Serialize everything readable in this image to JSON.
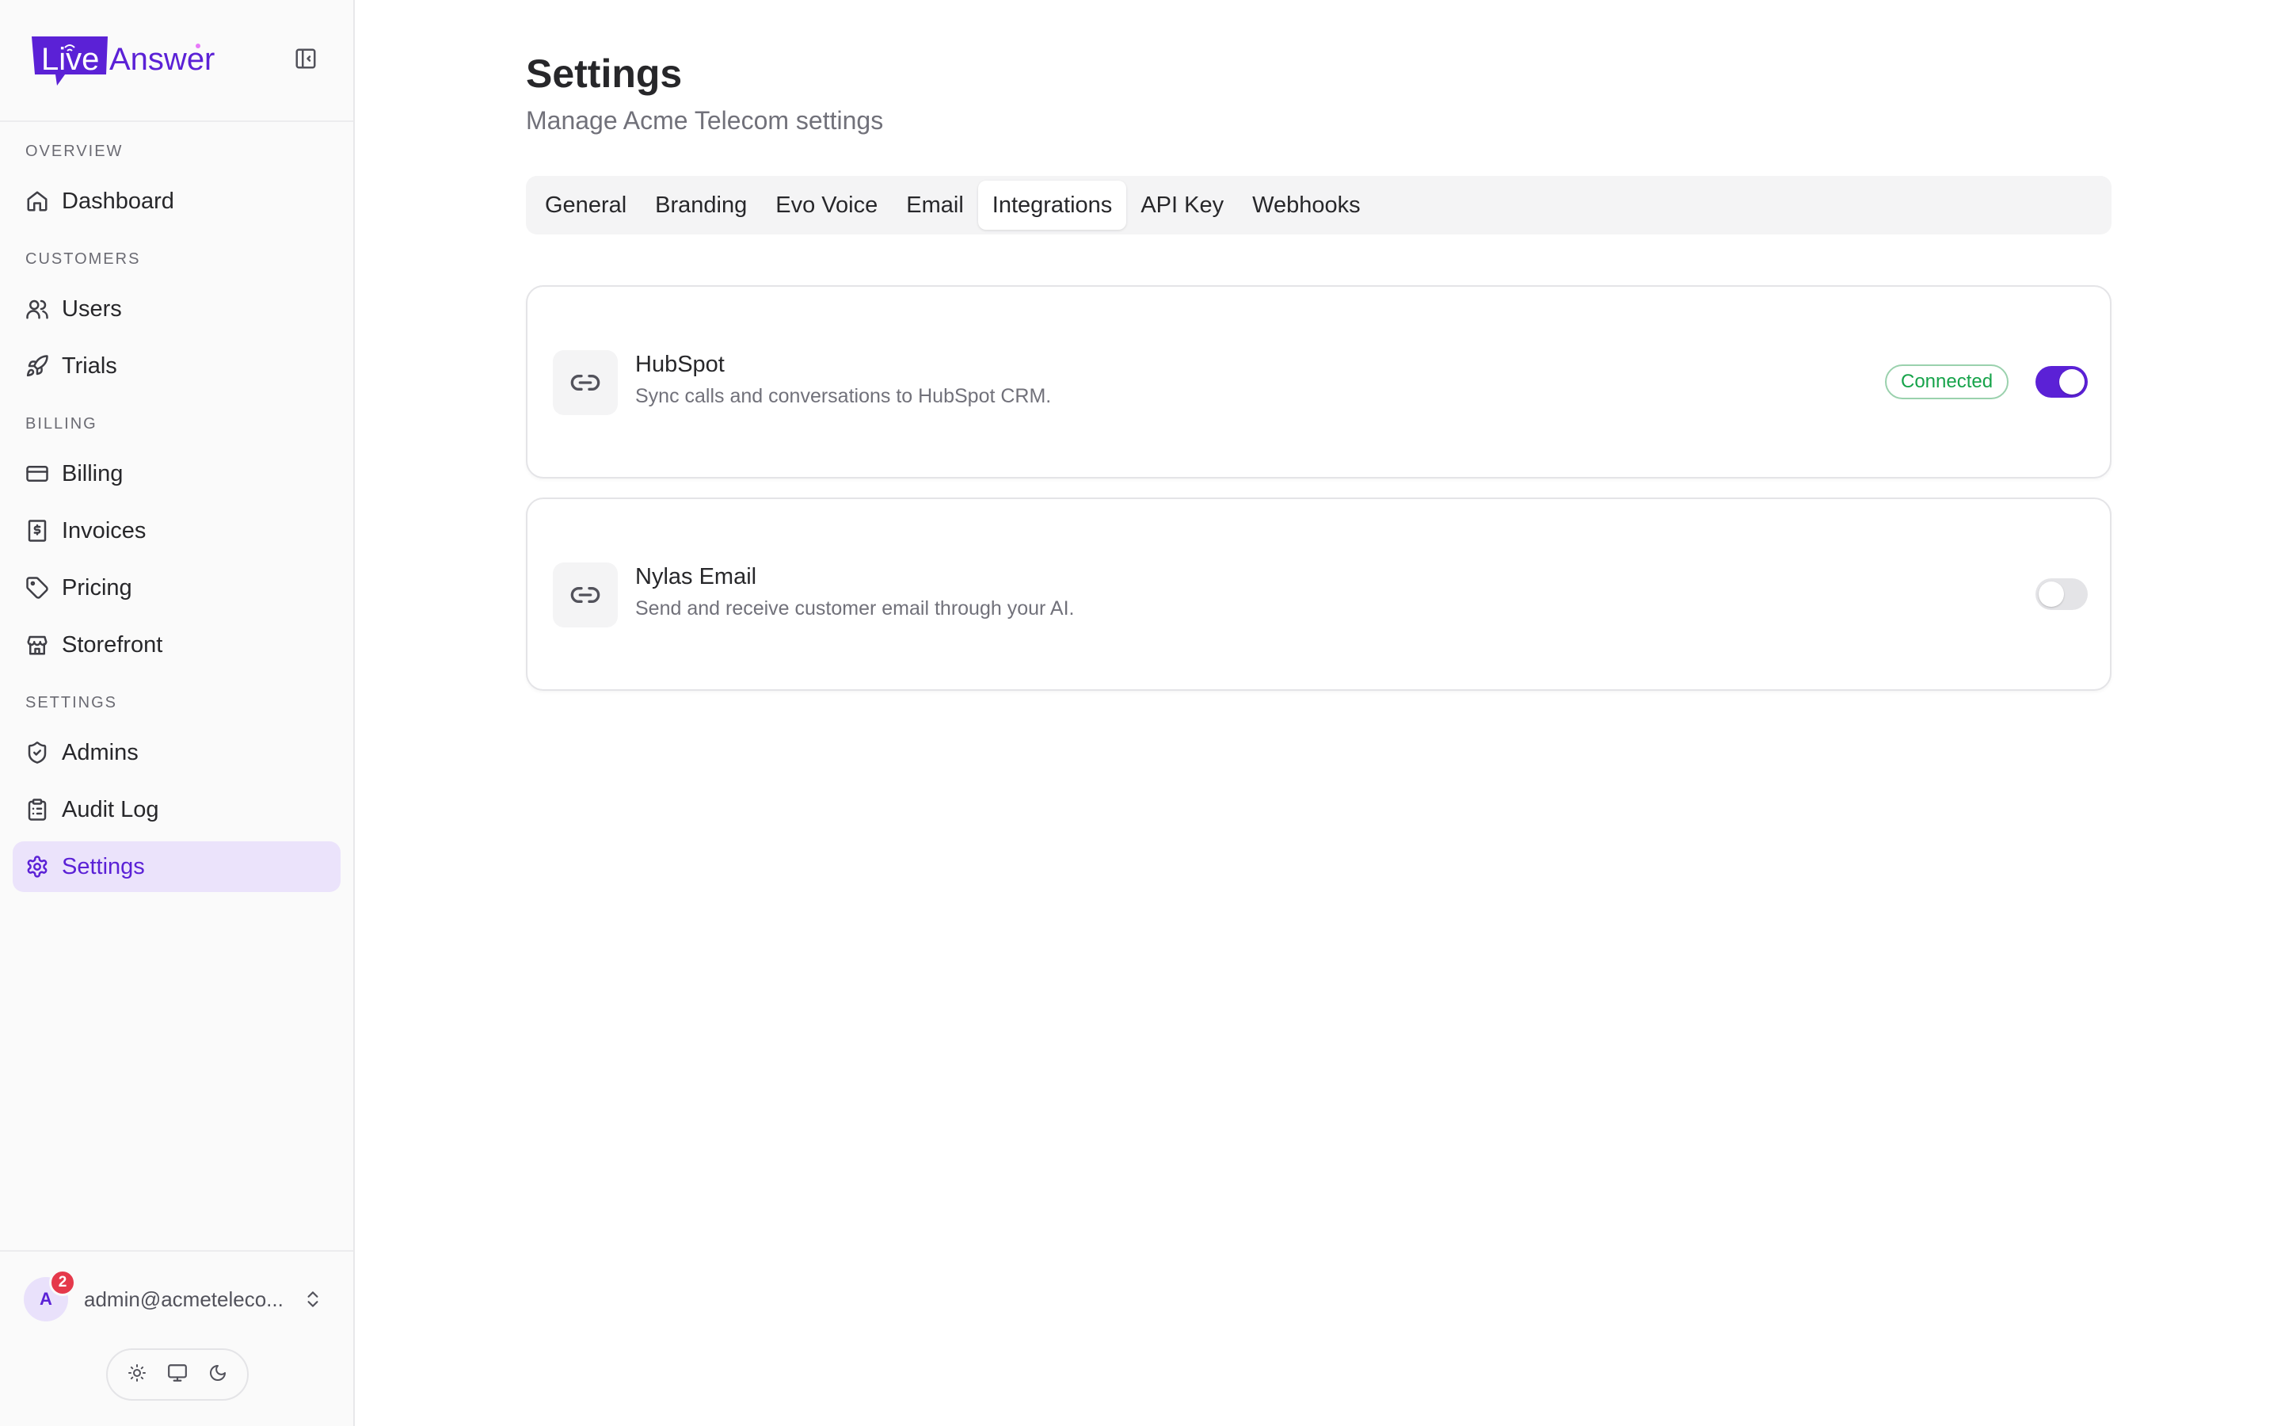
{
  "brand": {
    "logo_text_live": "Live",
    "logo_text_answer": "Answer",
    "primary_color": "#5b21d6"
  },
  "sidebar": {
    "collapse_icon": "panel-left-close-icon",
    "sections": [
      {
        "label": "OVERVIEW"
      },
      {
        "label": "CUSTOMERS"
      },
      {
        "label": "BILLING"
      },
      {
        "label": "SETTINGS"
      }
    ],
    "items": [
      {
        "label": "Dashboard",
        "icon": "home-icon"
      },
      {
        "label": "Users",
        "icon": "users-icon"
      },
      {
        "label": "Trials",
        "icon": "rocket-icon"
      },
      {
        "label": "Billing",
        "icon": "credit-card-icon"
      },
      {
        "label": "Invoices",
        "icon": "receipt-dollar-icon"
      },
      {
        "label": "Pricing",
        "icon": "tag-icon"
      },
      {
        "label": "Storefront",
        "icon": "store-icon"
      },
      {
        "label": "Admins",
        "icon": "shield-check-icon"
      },
      {
        "label": "Audit Log",
        "icon": "clipboard-list-icon"
      },
      {
        "label": "Settings",
        "icon": "gear-icon",
        "active": true
      }
    ],
    "user": {
      "avatar_initial": "A",
      "notification_count": "2",
      "email": "admin@acmeteleco..."
    },
    "theme": {
      "options": [
        "light",
        "system",
        "dark"
      ]
    }
  },
  "page": {
    "title": "Settings",
    "subtitle": "Manage Acme Telecom settings"
  },
  "tabs": [
    {
      "label": "General"
    },
    {
      "label": "Branding"
    },
    {
      "label": "Evo Voice"
    },
    {
      "label": "Email"
    },
    {
      "label": "Integrations",
      "active": true
    },
    {
      "label": "API Key"
    },
    {
      "label": "Webhooks"
    }
  ],
  "integrations": [
    {
      "name": "HubSpot",
      "description": "Sync calls and conversations to HubSpot CRM.",
      "status": "Connected",
      "enabled": true,
      "icon": "link-icon"
    },
    {
      "name": "Nylas Email",
      "description": "Send and receive customer email through your AI.",
      "status": "",
      "enabled": false,
      "icon": "link-icon"
    }
  ]
}
